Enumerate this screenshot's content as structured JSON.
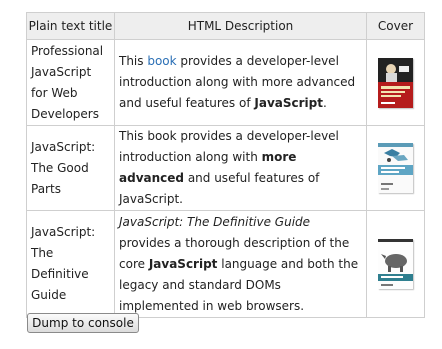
{
  "table": {
    "headers": {
      "title": "Plain text title",
      "description": "HTML Description",
      "cover": "Cover"
    },
    "rows": [
      {
        "title": "Professional JavaScript for Web Developers",
        "description": [
          {
            "text": "This "
          },
          {
            "text": "book",
            "link": true
          },
          {
            "text": " provides a developer-level introduction along with more advanced and useful features of "
          },
          {
            "text": "JavaScript",
            "bold": true
          },
          {
            "text": "."
          }
        ],
        "cover_icon": "book-cover-professional-javascript"
      },
      {
        "title": "JavaScript: The Good Parts",
        "description": [
          {
            "text": "This book provides a developer-level introduction along with "
          },
          {
            "text": "more advanced",
            "bold": true
          },
          {
            "text": " and useful features of JavaScript."
          }
        ],
        "cover_icon": "book-cover-javascript-the-good-parts"
      },
      {
        "title": "JavaScript: The Definitive Guide",
        "description": [
          {
            "text": "JavaScript: The Definitive Guide",
            "italic": true
          },
          {
            "text": " provides a thorough description of the core "
          },
          {
            "text": "JavaScript",
            "bold": true
          },
          {
            "text": " language and both the legacy and standard DOMs implemented in web browsers."
          }
        ],
        "cover_icon": "book-cover-javascript-definitive-guide"
      }
    ]
  },
  "button": {
    "label": "Dump to console"
  }
}
